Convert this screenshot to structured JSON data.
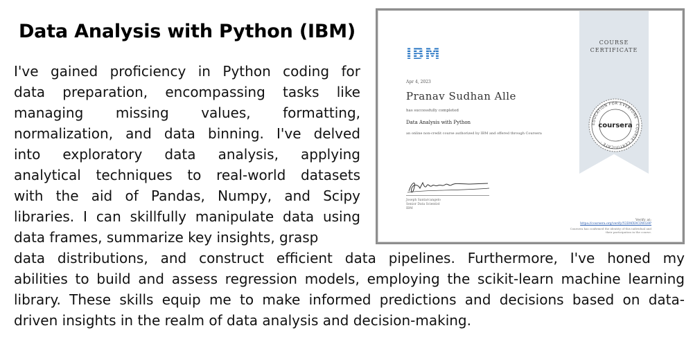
{
  "heading": "Data Analysis with Python (IBM)",
  "paragraph_top_lines": [
    "I've gained proficiency in Python coding for",
    "data preparation, encompassing tasks like",
    "managing missing values, formatting,",
    "normalization, and data binning. I've delved",
    "into exploratory data analysis, applying",
    "analytical techniques to real-world datasets",
    "with the aid of Pandas, Numpy, and Scipy",
    "libraries. I can skillfully manipulate data using",
    "data frames, summarize key insights, grasp"
  ],
  "paragraph_bottom_lines": [
    "data distributions, and construct efficient data pipelines. Furthermore, I've honed my",
    "abilities to build and assess regression models, employing the scikit-learn machine learning",
    "library. These skills equip me to make informed predictions and decisions based on data-",
    "driven insights in the realm of data analysis and decision-making."
  ],
  "certificate": {
    "issuer_logo": "IBM",
    "date": "Apr 4, 2023",
    "recipient": "Pranav Sudhan Alle",
    "completed_text": "has successfully completed",
    "course": "Data Analysis with Python",
    "description": "an online non-credit course authorized by IBM and offered through Coursera",
    "signer_name": "Joseph Santarcangelo",
    "signer_title": "Senior Data Scientist",
    "signer_org": "IBM",
    "ribbon_line1": "COURSE",
    "ribbon_line2": "CERTIFICATE",
    "seal_brand": "coursera",
    "seal_ring_text": "EDUCATION FOR EVERYONE · COURSE CERTIFICATE ·",
    "verify_label": "Verify at:",
    "verify_url": "https://coursera.org/verify/Y2DMX9CDWG9P",
    "verify_note": "Coursera has confirmed the identity of this individual and their participation in the course."
  },
  "colors": {
    "ibm_blue": "#1f70c1",
    "ribbon": "#dfe5eb",
    "frame": "#8e8e8e"
  }
}
